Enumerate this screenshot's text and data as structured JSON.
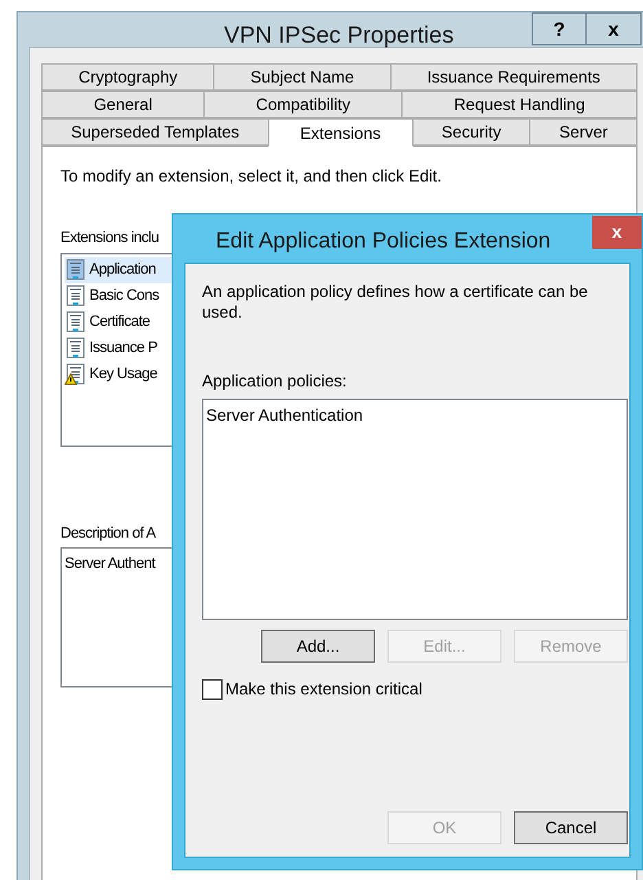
{
  "window": {
    "title": "VPN IPSec Properties",
    "help": "?",
    "close": "x"
  },
  "tab_rows": [
    [
      {
        "label": "Cryptography",
        "selected": false
      },
      {
        "label": "Subject Name",
        "selected": false
      },
      {
        "label": "Issuance Requirements",
        "selected": false
      }
    ],
    [
      {
        "label": "General",
        "selected": false
      },
      {
        "label": "Compatibility",
        "selected": false
      },
      {
        "label": "Request Handling",
        "selected": false
      }
    ],
    [
      {
        "label": "Superseded Templates",
        "selected": false
      },
      {
        "label": "Extensions",
        "selected": true
      },
      {
        "label": "Security",
        "selected": false
      },
      {
        "label": "Server",
        "selected": false
      }
    ]
  ],
  "instruction": "To modify an extension, select it, and then click Edit.",
  "extensions_label": "Extensions inclu",
  "extensions": [
    {
      "label": "Application",
      "selected": true,
      "warning": false
    },
    {
      "label": "Basic Cons",
      "selected": false,
      "warning": false
    },
    {
      "label": "Certificate",
      "selected": false,
      "warning": false
    },
    {
      "label": "Issuance P",
      "selected": false,
      "warning": false
    },
    {
      "label": "Key Usage",
      "selected": false,
      "warning": true
    }
  ],
  "description_label": "Description of A",
  "description": "Server Authent",
  "dialog": {
    "title": "Edit Application Policies Extension",
    "close": "x",
    "intro": "An application policy defines how a certificate can be used.",
    "policies_label": "Application policies:",
    "policies": [
      "Server Authentication"
    ],
    "list_buttons": [
      {
        "label": "Add...",
        "disabled": false
      },
      {
        "label": "Edit...",
        "disabled": true
      },
      {
        "label": "Remove",
        "disabled": true
      }
    ],
    "critical": {
      "label": "Make this extension critical",
      "checked": false
    },
    "buttons": [
      {
        "label": "OK",
        "disabled": true
      },
      {
        "label": "Cancel",
        "disabled": false
      }
    ]
  }
}
